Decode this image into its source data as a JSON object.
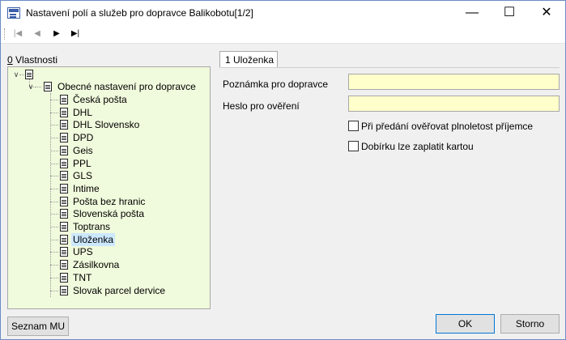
{
  "window": {
    "title": "Nastavení polí a služeb pro dopravce Balikobotu[1/2]"
  },
  "window_controls": {
    "minimize": "—",
    "maximize": "☐",
    "close": "✕"
  },
  "toolbar": {
    "first": "|◀",
    "prev": "◀",
    "next": "▶",
    "last": "▶|"
  },
  "left_panel": {
    "label_prefix": "0",
    "label_rest": " Vlastnosti"
  },
  "tree": {
    "root": {
      "label": ""
    },
    "group": {
      "label": "Obecné nastavení pro dopravce"
    },
    "items": [
      "Česká pošta",
      "DHL",
      "DHL Slovensko",
      "DPD",
      "Geis",
      "PPL",
      "GLS",
      "Intime",
      "Pošta bez hranic",
      "Slovenská pošta",
      "Toptrans",
      "Uloženka",
      "UPS",
      "Zásilkovna",
      "TNT",
      "Slovak parcel dervice"
    ],
    "selected": "Uloženka"
  },
  "tab": {
    "label": "1 Uloženka"
  },
  "form": {
    "note_label": "Poznámka pro dopravce",
    "note_value": "",
    "password_label": "Heslo pro ověření",
    "password_value": "",
    "check_age_label": "Při předání ověřovat plnoletost příjemce",
    "check_age_checked": false,
    "cod_card_label": "Dobírku lze zaplatit kartou",
    "cod_card_checked": false
  },
  "buttons": {
    "seznam_mu": "Seznam MU",
    "ok": "OK",
    "cancel": "Storno"
  },
  "colors": {
    "tree_bg": "#f0fadc",
    "input_bg": "#ffffcc",
    "selection": "#cce8ff"
  }
}
